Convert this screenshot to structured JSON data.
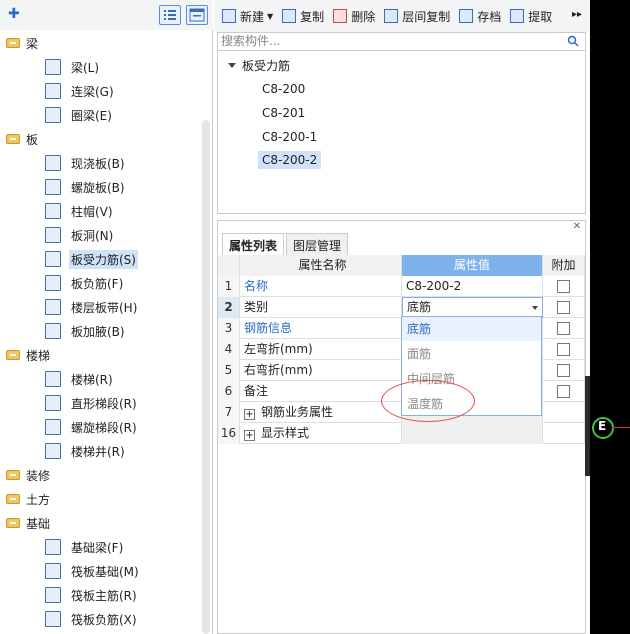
{
  "left_tree": {
    "categories": [
      {
        "label": "梁",
        "items": [
          "梁(L)",
          "连梁(G)",
          "圈梁(E)"
        ]
      },
      {
        "label": "板",
        "items": [
          "现浇板(B)",
          "螺旋板(B)",
          "柱帽(V)",
          "板洞(N)",
          "板受力筋(S)",
          "板负筋(F)",
          "楼层板带(H)",
          "板加腋(B)"
        ]
      },
      {
        "label": "楼梯",
        "items": [
          "楼梯(R)",
          "直形梯段(R)",
          "螺旋梯段(R)",
          "楼梯井(R)"
        ]
      },
      {
        "label": "装修",
        "items": []
      },
      {
        "label": "土方",
        "items": []
      },
      {
        "label": "基础",
        "items": [
          "基础梁(F)",
          "筏板基础(M)",
          "筏板主筋(R)",
          "筏板负筋(X)"
        ]
      }
    ],
    "selected_item": "板受力筋(S)"
  },
  "toolbar": {
    "new_label": "新建",
    "copy_label": "复制",
    "delete_label": "删除",
    "floor_copy_label": "层间复制",
    "save_label": "存档",
    "extract_label": "提取"
  },
  "search": {
    "placeholder": "搜索构件..."
  },
  "component_list": {
    "root": "板受力筋",
    "items": [
      "C8-200",
      "C8-201",
      "C8-200-1",
      "C8-200-2"
    ],
    "selected": "C8-200-2"
  },
  "property_panel": {
    "tabs": [
      "属性列表",
      "图层管理"
    ],
    "headers": {
      "name": "属性名称",
      "value": "属性值",
      "extra": "附加"
    },
    "rows": [
      {
        "num": "1",
        "name": "名称",
        "value": "C8-200-2"
      },
      {
        "num": "2",
        "name": "类别",
        "value": "底筋"
      },
      {
        "num": "3",
        "name": "钢筋信息",
        "value": ""
      },
      {
        "num": "4",
        "name": "左弯折(mm)",
        "value": ""
      },
      {
        "num": "5",
        "name": "右弯折(mm)",
        "value": ""
      },
      {
        "num": "6",
        "name": "备注",
        "value": ""
      },
      {
        "num": "7",
        "name": "钢筋业务属性",
        "value": ""
      },
      {
        "num": "16",
        "name": "显示样式",
        "value": ""
      }
    ],
    "dropdown_options": [
      "底筋",
      "面筋",
      "中间层筋",
      "温度筋"
    ]
  },
  "canvas": {
    "cursor_label": "E"
  }
}
